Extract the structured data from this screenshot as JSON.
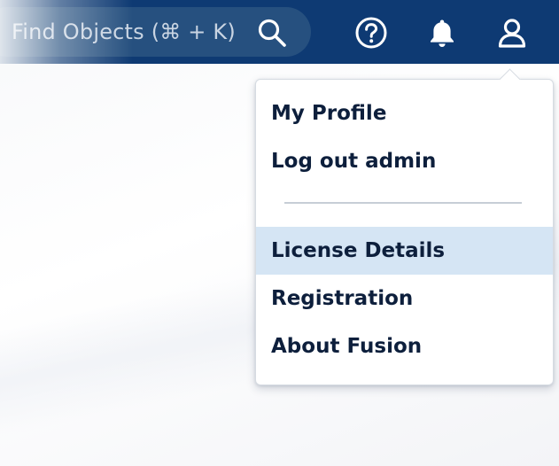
{
  "search": {
    "placeholder": "Find Objects (⌘ + K)",
    "icon": "search-icon"
  },
  "topbar": {
    "color": "#0e3a73",
    "icons": [
      "help-icon",
      "bell-icon",
      "user-icon"
    ]
  },
  "user_menu": {
    "group_one": [
      {
        "label": "My Profile"
      },
      {
        "label": "Log out admin"
      }
    ],
    "group_two": [
      {
        "label": "License Details",
        "highlighted": true
      },
      {
        "label": "Registration"
      },
      {
        "label": "About Fusion"
      }
    ],
    "highlight_color": "#d5e5f4"
  }
}
